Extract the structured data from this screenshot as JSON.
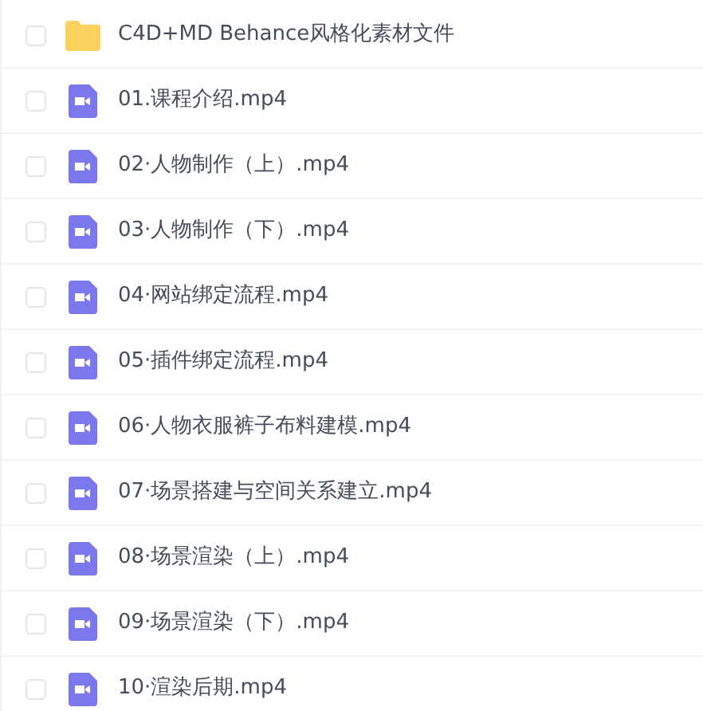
{
  "files": [
    {
      "kind": "folder",
      "name": "C4D+MD Behance风格化素材文件",
      "checked": false
    },
    {
      "kind": "video",
      "name": "01.课程介绍.mp4",
      "checked": false
    },
    {
      "kind": "video",
      "name": "02·人物制作（上）.mp4",
      "checked": false
    },
    {
      "kind": "video",
      "name": "03·人物制作（下）.mp4",
      "checked": false
    },
    {
      "kind": "video",
      "name": "04·网站绑定流程.mp4",
      "checked": false
    },
    {
      "kind": "video",
      "name": "05·插件绑定流程.mp4",
      "checked": false
    },
    {
      "kind": "video",
      "name": "06·人物衣服裤子布料建模.mp4",
      "checked": false
    },
    {
      "kind": "video",
      "name": "07·场景搭建与空间关系建立.mp4",
      "checked": false
    },
    {
      "kind": "video",
      "name": "08·场景渲染（上）.mp4",
      "checked": false
    },
    {
      "kind": "video",
      "name": "09·场景渲染（下）.mp4",
      "checked": false
    },
    {
      "kind": "video",
      "name": "10·渲染后期.mp4",
      "checked": false
    }
  ]
}
